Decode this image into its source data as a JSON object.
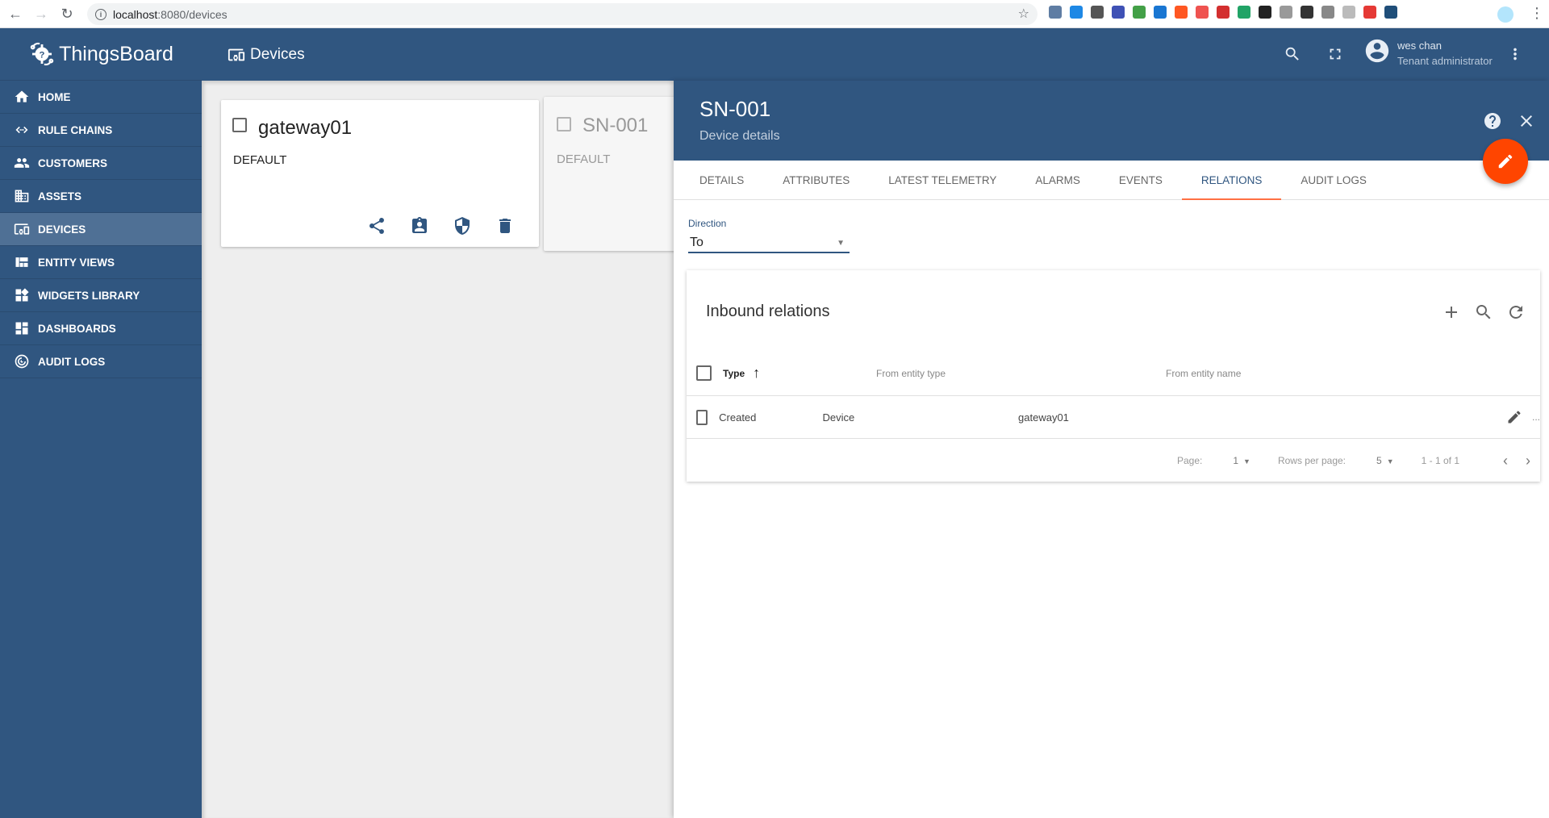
{
  "browser": {
    "url_host": "localhost",
    "url_path": ":8080/devices",
    "extensions": [
      "#5f7da3",
      "#1e88e5",
      "#555555",
      "#3f51b5",
      "#43a047",
      "#1976d2",
      "#ff5722",
      "#ef5350",
      "#d32f2f",
      "#21a366",
      "#222222",
      "#999999",
      "#333333",
      "#888888",
      "#bbbbbb",
      "#e53935",
      "#1f4e79"
    ]
  },
  "app": {
    "brand": "ThingsBoard",
    "page_title": "Devices",
    "colors": {
      "primary": "#305680",
      "accent": "#ff4500",
      "active_nav": "#4f7095",
      "tab_underline": "#ff7043"
    }
  },
  "user": {
    "name": "wes chan",
    "role": "Tenant administrator"
  },
  "sidebar": {
    "items": [
      {
        "label": "HOME",
        "icon": "home-icon"
      },
      {
        "label": "RULE CHAINS",
        "icon": "rule-chains-icon"
      },
      {
        "label": "CUSTOMERS",
        "icon": "customers-icon"
      },
      {
        "label": "ASSETS",
        "icon": "assets-icon"
      },
      {
        "label": "DEVICES",
        "icon": "devices-icon",
        "active": true
      },
      {
        "label": "ENTITY VIEWS",
        "icon": "entity-views-icon"
      },
      {
        "label": "WIDGETS LIBRARY",
        "icon": "widgets-icon"
      },
      {
        "label": "DASHBOARDS",
        "icon": "dashboards-icon"
      },
      {
        "label": "AUDIT LOGS",
        "icon": "audit-logs-icon"
      }
    ]
  },
  "devices": [
    {
      "name": "gateway01",
      "type": "DEFAULT"
    },
    {
      "name": "SN-001",
      "type": "DEFAULT"
    }
  ],
  "details": {
    "title": "SN-001",
    "subtitle": "Device details",
    "tabs": [
      {
        "label": "DETAILS"
      },
      {
        "label": "ATTRIBUTES"
      },
      {
        "label": "LATEST TELEMETRY"
      },
      {
        "label": "ALARMS"
      },
      {
        "label": "EVENTS"
      },
      {
        "label": "RELATIONS",
        "active": true
      },
      {
        "label": "AUDIT LOGS"
      }
    ],
    "direction": {
      "label": "Direction",
      "value": "To"
    },
    "relations": {
      "title": "Inbound relations",
      "columns": {
        "type": "Type",
        "from_type": "From entity type",
        "from_name": "From entity name"
      },
      "rows": [
        {
          "type": "Created",
          "from_type": "Device",
          "from_name": "gateway01"
        }
      ],
      "more": "...",
      "pager": {
        "page_label": "Page:",
        "page_value": "1",
        "rows_label": "Rows per page:",
        "rows_value": "5",
        "range": "1 - 1 of 1"
      }
    }
  }
}
